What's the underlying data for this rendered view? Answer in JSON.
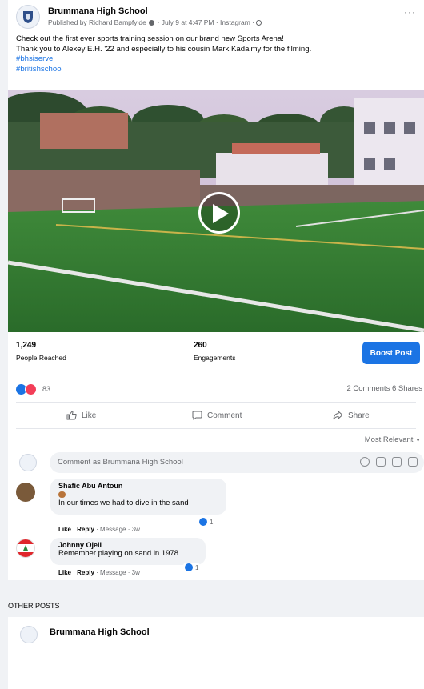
{
  "post": {
    "page_name": "Brummana High School",
    "meta": "Published by Richard Bampfylde",
    "meta_suffix": "· July 9 at 4:47 PM · Instagram ·",
    "more": "···",
    "text_line1": "Check out the first ever sports training session on our brand new Sports Arena!",
    "text_line2": "Thank you to Alexey E.H. '22 and especially to his cousin Mark Kadaimy for the filming.",
    "hashtags": [
      "#bhsiserve",
      "#britishschool"
    ]
  },
  "insights": {
    "reached_value": "1,249",
    "reached_label": "People Reached",
    "engagements_value": "260",
    "engagements_label": "Engagements",
    "boost_label": "Boost Post"
  },
  "reactions": {
    "count": "83",
    "comments": "2 Comments",
    "shares": "6 Shares"
  },
  "actions": {
    "like": "Like",
    "comment": "Comment",
    "share": "Share"
  },
  "sort": {
    "label": "Most Relevant"
  },
  "compose": {
    "placeholder": "Comment as Brummana High School"
  },
  "comments": [
    {
      "author": "Shafic Abu Antoun",
      "text": "In our times we had to dive in the sand",
      "like": "Like",
      "reply": "Reply",
      "rest": "· Message · 3w",
      "reactions": "1"
    },
    {
      "author": "Johnny Ojeil",
      "text": "Remember playing on sand in 1978",
      "like": "Like",
      "reply": "Reply",
      "rest": "· Message · 3w",
      "reactions": "1"
    }
  ],
  "other_posts": {
    "heading": "OTHER POSTS",
    "page_name": "Brummana High School"
  },
  "colors": {
    "accent": "#1b74e4",
    "love": "#f33e58",
    "background": "#f0f2f5"
  }
}
